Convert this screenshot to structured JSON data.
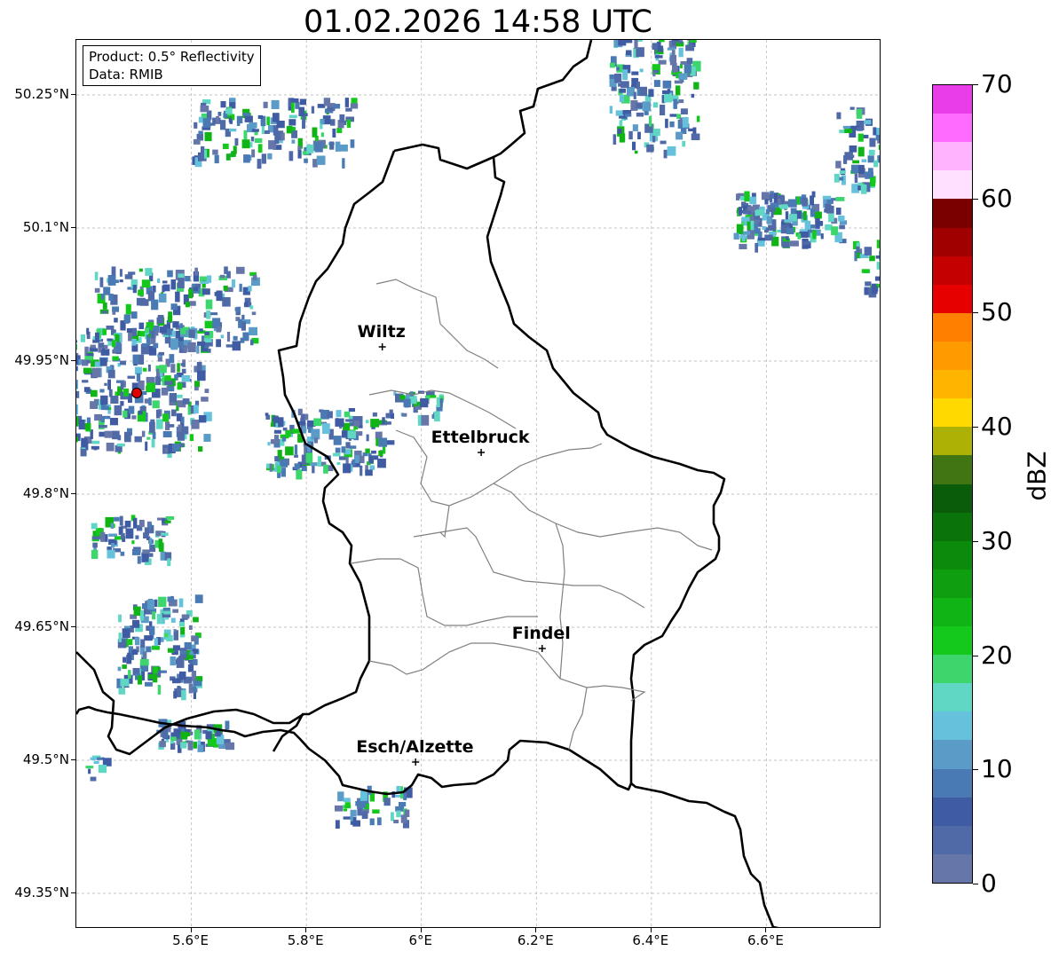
{
  "title": "01.02.2026 14:58 UTC",
  "info": {
    "product": "Product: 0.5° Reflectivity",
    "data": "Data: RMIB"
  },
  "map_extent": {
    "lon": [
      5.4,
      6.8
    ],
    "lat": [
      49.31,
      50.312
    ]
  },
  "y_ticks": [
    {
      "label": "50.25°N",
      "lat": 50.25
    },
    {
      "label": "50.1°N",
      "lat": 50.1
    },
    {
      "label": "49.95°N",
      "lat": 49.95
    },
    {
      "label": "49.8°N",
      "lat": 49.8
    },
    {
      "label": "49.65°N",
      "lat": 49.65
    },
    {
      "label": "49.5°N",
      "lat": 49.5
    },
    {
      "label": "49.35°N",
      "lat": 49.35
    }
  ],
  "x_ticks": [
    {
      "label": "5.6°E",
      "lon": 5.6
    },
    {
      "label": "5.8°E",
      "lon": 5.8
    },
    {
      "label": "6°E",
      "lon": 6.0
    },
    {
      "label": "6.2°E",
      "lon": 6.2
    },
    {
      "label": "6.4°E",
      "lon": 6.4
    },
    {
      "label": "6.6°E",
      "lon": 6.6
    }
  ],
  "cities": [
    {
      "name": "Wiltz",
      "lon": 5.932,
      "lat": 49.966
    },
    {
      "name": "Ettelbruck",
      "lon": 6.104,
      "lat": 49.847
    },
    {
      "name": "Findel",
      "lon": 6.21,
      "lat": 49.626
    },
    {
      "name": "Esch/Alzette",
      "lon": 5.99,
      "lat": 49.498
    }
  ],
  "radar_site": {
    "lon": 5.505,
    "lat": 49.914,
    "color": "#e00000"
  },
  "colorbar": {
    "label": "dBZ",
    "min": 0,
    "max": 70,
    "ticks": [
      "0",
      "10",
      "20",
      "30",
      "40",
      "50",
      "60",
      "70"
    ],
    "colors": [
      "#6676a8",
      "#4f6aa6",
      "#3f5ba3",
      "#4a7ab3",
      "#5a9bc8",
      "#66c2dc",
      "#60d6c4",
      "#3dd66c",
      "#14c81c",
      "#10b414",
      "#0f9e10",
      "#0c8a0c",
      "#0a730a",
      "#0a5c0a",
      "#417512",
      "#adb005",
      "#ffd900",
      "#ffb400",
      "#ff9b00",
      "#ff7f00",
      "#e60000",
      "#c40000",
      "#a00000",
      "#7a0000",
      "#ffe0ff",
      "#ffb3ff",
      "#ff6bff",
      "#e83de8"
    ]
  },
  "colors": {
    "border": "#000000",
    "canton_lines": "#808080",
    "grid": "#b0b0b0"
  }
}
